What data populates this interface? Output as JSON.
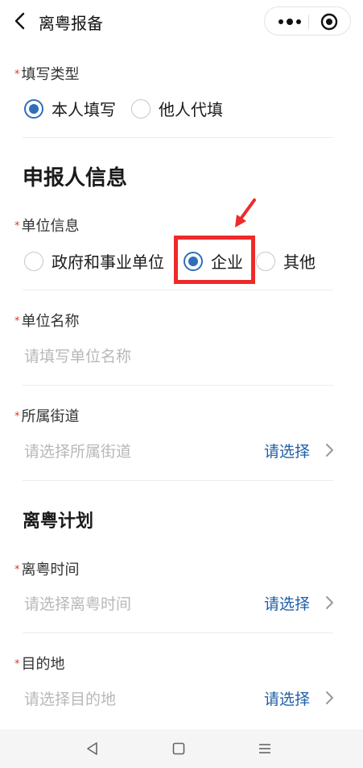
{
  "header": {
    "title": "离粤报备"
  },
  "form": {
    "fill_type": {
      "label": "填写类型",
      "options": [
        "本人填写",
        "他人代填"
      ],
      "selected": 0
    },
    "section_applicant": "申报人信息",
    "unit_info": {
      "label": "单位信息",
      "options": [
        "政府和事业单位",
        "企业",
        "其他"
      ],
      "selected": 1
    },
    "unit_name": {
      "label": "单位名称",
      "placeholder": "请填写单位名称"
    },
    "street": {
      "label": "所属街道",
      "placeholder": "请选择所属街道",
      "action": "请选择"
    },
    "section_plan": "离粤计划",
    "leave_time": {
      "label": "离粤时间",
      "placeholder": "请选择离粤时间",
      "action": "请选择"
    },
    "destination": {
      "label": "目的地",
      "placeholder": "请选择目的地",
      "action": "请选择"
    },
    "required_mark": "*"
  },
  "colors": {
    "accent": "#2f6fba",
    "link": "#1f5fa6",
    "required": "#e5332a",
    "annotation": "#ee2a2a"
  },
  "icons": [
    "back-icon",
    "more-icon",
    "target-icon",
    "chevron-right-icon",
    "nav-back-icon",
    "nav-home-icon",
    "nav-menu-icon"
  ]
}
